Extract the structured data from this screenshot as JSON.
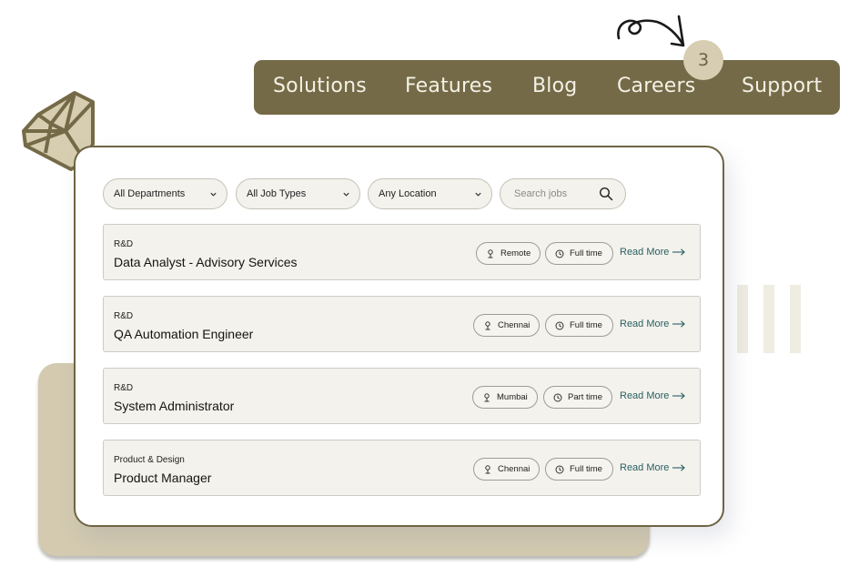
{
  "nav": {
    "items": [
      "Solutions",
      "Features",
      "Blog",
      "Careers",
      "Support"
    ],
    "badge_count": "3",
    "background_color": "#756a47",
    "badge_color": "#d6cdb2"
  },
  "filters": {
    "department": "All Departments",
    "job_type": "All Job Types",
    "location": "Any Location",
    "search_placeholder": "Search jobs"
  },
  "jobs": [
    {
      "department": "R&D",
      "title": "Data Analyst - Advisory Services",
      "location": "Remote",
      "type": "Full time",
      "link": "Read More"
    },
    {
      "department": "R&D",
      "title": "QA Automation Engineer",
      "location": "Chennai",
      "type": "Full time",
      "link": "Read More"
    },
    {
      "department": "R&D",
      "title": "System Administrator",
      "location": "Mumbai",
      "type": "Part time",
      "link": "Read More"
    },
    {
      "department": "Product & Design",
      "title": "Product Manager",
      "location": "Chennai",
      "type": "Full time",
      "link": "Read More"
    }
  ],
  "colors": {
    "accent": "#756a47",
    "link": "#2b5f66",
    "card_back": "#d3cab0"
  }
}
